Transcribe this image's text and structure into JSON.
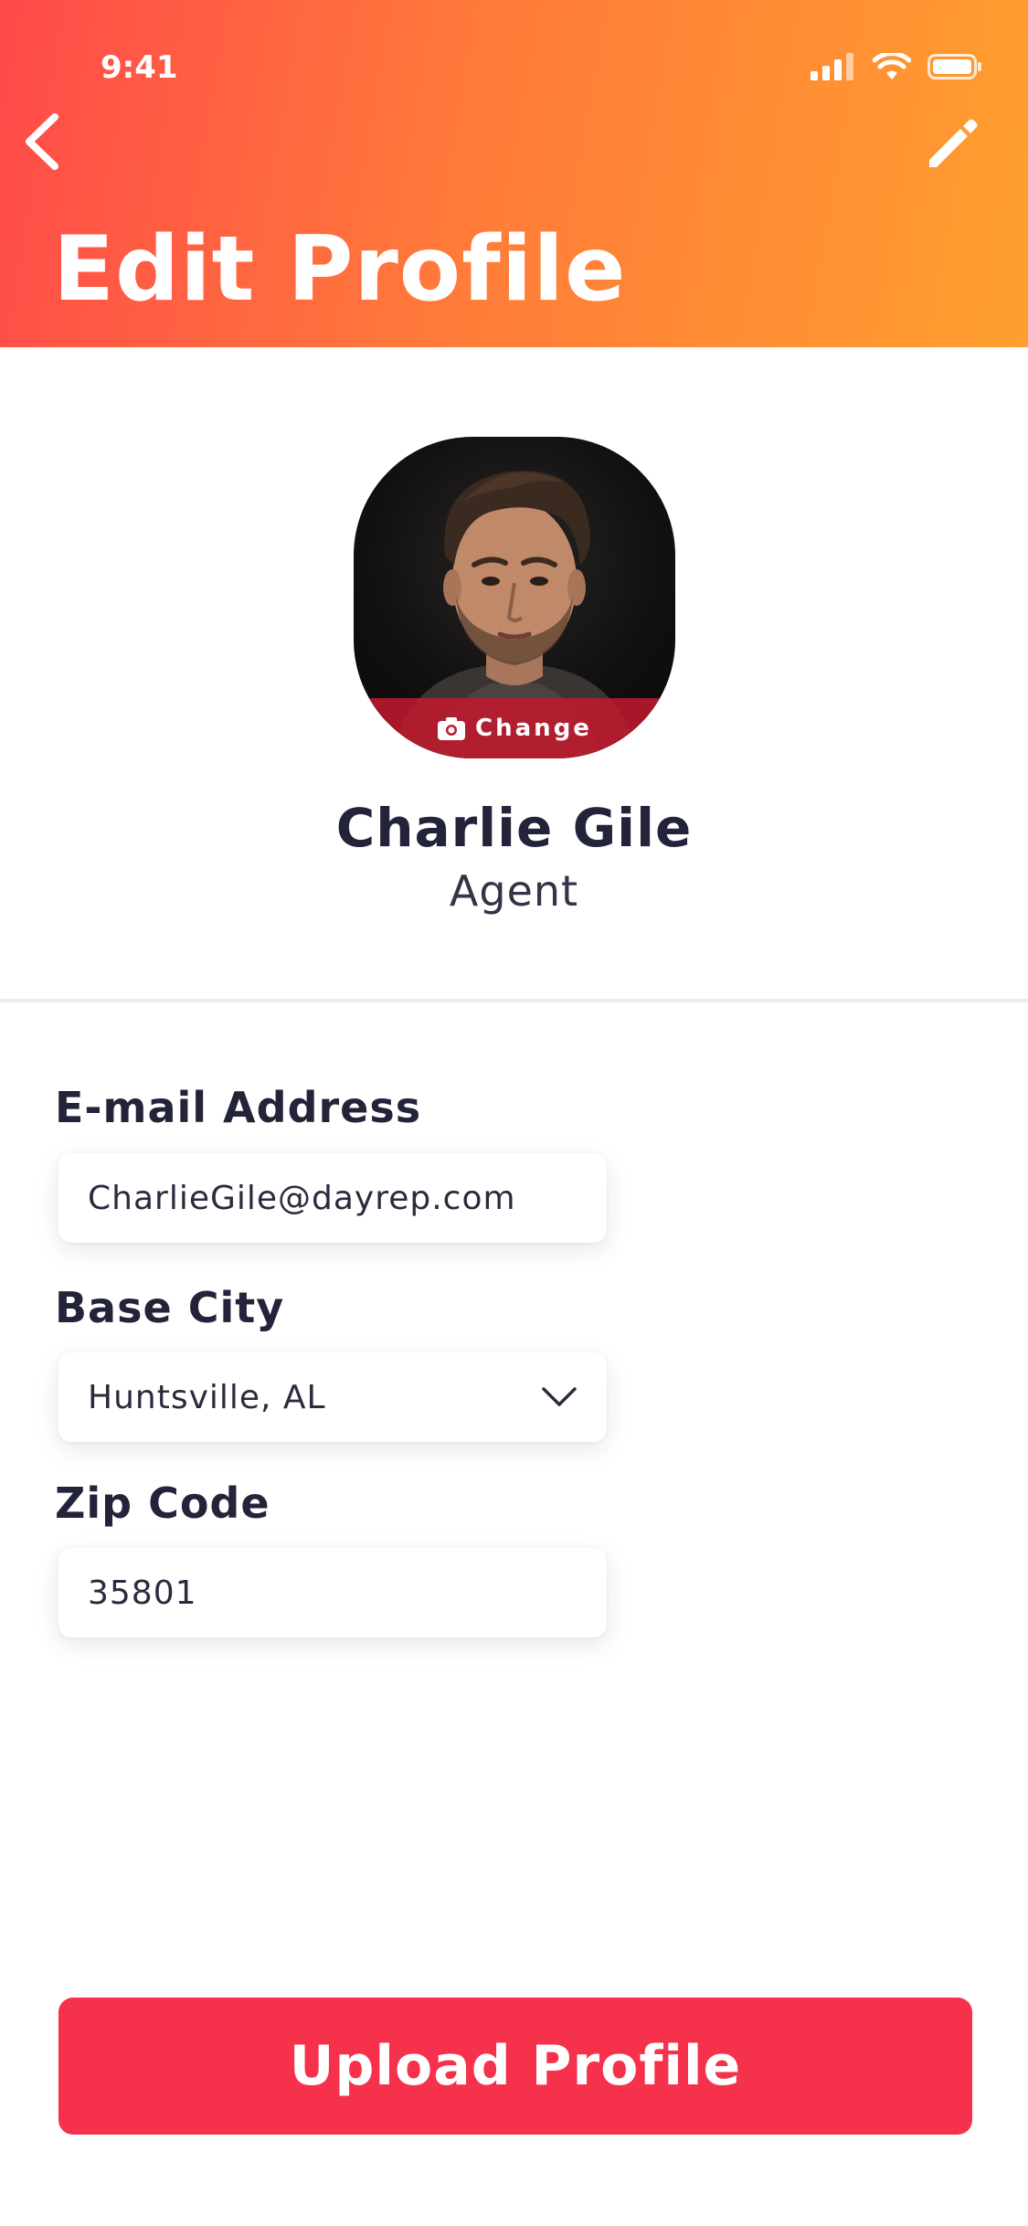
{
  "status_bar": {
    "time": "9:41"
  },
  "header": {
    "title": "Edit Profile"
  },
  "profile": {
    "change_label": "Change",
    "name": "Charlie Gile",
    "role": "Agent"
  },
  "fields": {
    "email": {
      "label": "E-mail Address",
      "value": "CharlieGile@dayrep.com"
    },
    "city": {
      "label": "Base City",
      "value": "Huntsville, AL"
    },
    "zip": {
      "label": "Zip Code",
      "value": "35801"
    }
  },
  "actions": {
    "upload_label": "Upload Profile"
  },
  "colors": {
    "header_gradient_start": "#ff4a4a",
    "header_gradient_end": "#ff9f2e",
    "button": "#f5314b",
    "text_dark": "#23233a"
  },
  "icons": [
    "back-arrow-icon",
    "pencil-icon",
    "camera-icon",
    "chevron-down-icon",
    "signal-icon",
    "wifi-icon",
    "battery-icon"
  ]
}
